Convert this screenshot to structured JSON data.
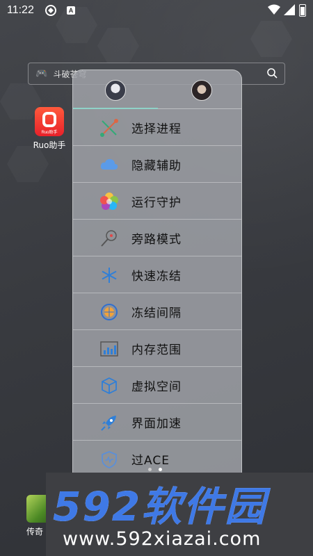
{
  "status_bar": {
    "time": "11:22",
    "app_badge": "A"
  },
  "search": {
    "text": "斗破苍穹"
  },
  "desktop_apps": [
    {
      "label": "Ruo助手",
      "icon_caption": "Ruo助手"
    },
    {
      "label": "传奇"
    }
  ],
  "menu": {
    "items": [
      {
        "label": "选择进程",
        "icon": "select-process-icon"
      },
      {
        "label": "隐藏辅助",
        "icon": "cloud-icon"
      },
      {
        "label": "运行守护",
        "icon": "flower-icon"
      },
      {
        "label": "旁路模式",
        "icon": "magnifier-icon"
      },
      {
        "label": "快速冻结",
        "icon": "snowflake-icon"
      },
      {
        "label": "冻结间隔",
        "icon": "interval-icon"
      },
      {
        "label": "内存范围",
        "icon": "memory-chart-icon"
      },
      {
        "label": "虚拟空间",
        "icon": "cube-icon"
      },
      {
        "label": "界面加速",
        "icon": "rocket-icon"
      },
      {
        "label": "过ACE",
        "icon": "shield-icon"
      }
    ]
  },
  "watermark": {
    "brand": "592软件园",
    "url": "www.592xiazai.com"
  },
  "colors": {
    "tab_indicator": "#8fd3c8",
    "watermark_blue": "#3f79e6"
  }
}
